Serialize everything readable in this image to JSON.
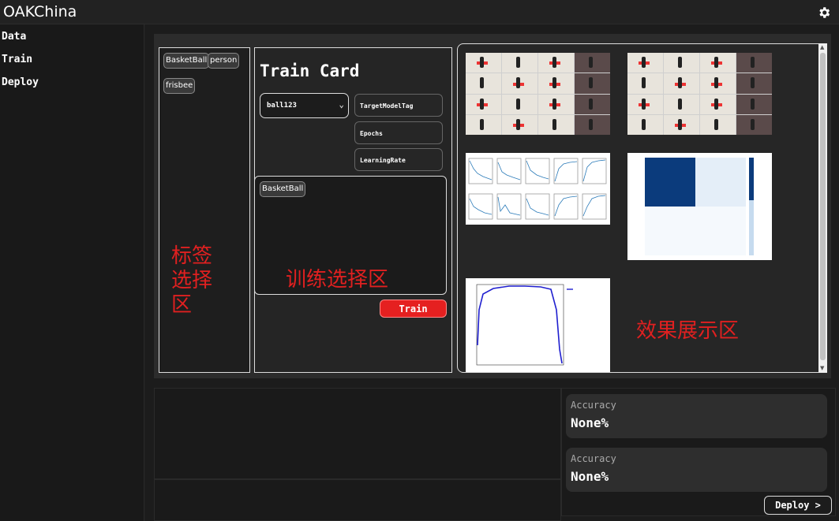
{
  "app": {
    "title": "OAKChina"
  },
  "header": {
    "settings_icon": "gear-icon"
  },
  "sidebar": {
    "items": [
      {
        "label": "Data"
      },
      {
        "label": "Train"
      },
      {
        "label": "Deploy"
      }
    ]
  },
  "labels": {
    "chips": [
      {
        "label": "BasketBall"
      },
      {
        "label": "person"
      },
      {
        "label": "frisbee"
      }
    ]
  },
  "train_card": {
    "title": "Train Card",
    "model_select": {
      "value": "ball123"
    },
    "fields": [
      {
        "label": "TargetModelTag"
      },
      {
        "label": "Epochs"
      },
      {
        "label": "LearningRate"
      }
    ],
    "selected_chips": [
      {
        "label": "BasketBall"
      }
    ],
    "train_button": "Train"
  },
  "annotations": {
    "label_area": "标签\n选择\n区",
    "train_area": "训练选择区",
    "result_area": "效果展示区"
  },
  "metrics": [
    {
      "label": "Accuracy",
      "value": "None%"
    },
    {
      "label": "Accuracy",
      "value": "None%"
    }
  ],
  "deploy_button": "Deploy >",
  "colors": {
    "accent": "#e52020",
    "background": "#1e1e1e",
    "annotation": "#e02020"
  }
}
